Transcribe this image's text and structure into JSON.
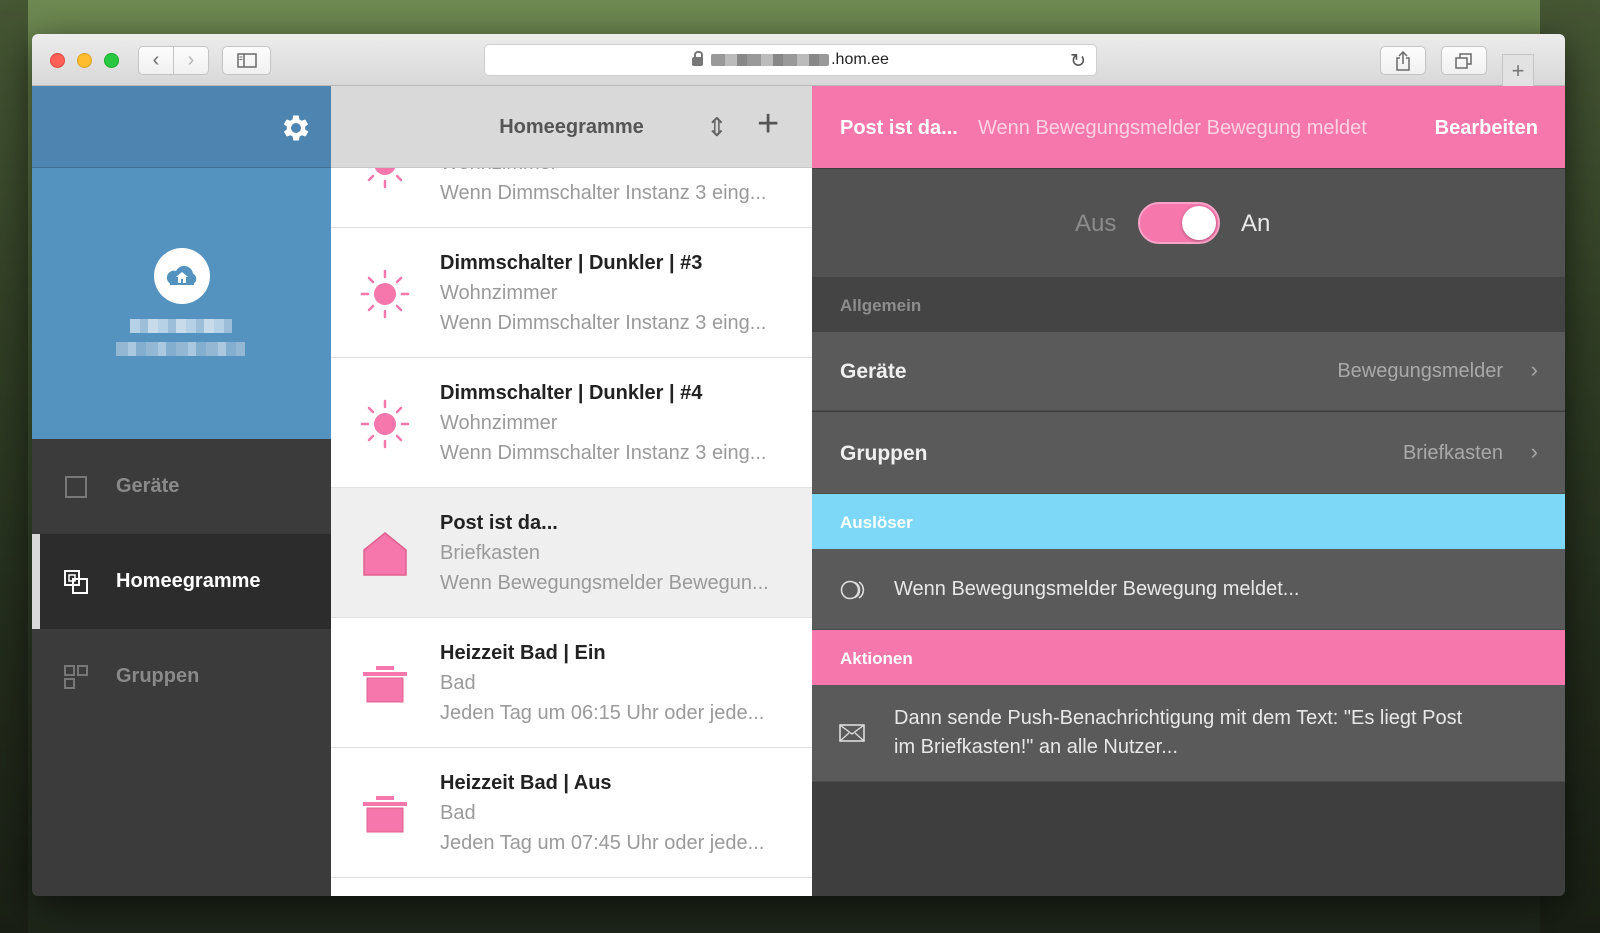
{
  "browser": {
    "url_suffix": ".hom.ee",
    "colors": {
      "close": "#fe5f57",
      "minimize": "#febc2e",
      "maximize": "#28c840"
    }
  },
  "sidebar": {
    "nav": [
      {
        "label": "Geräte",
        "icon": "square-icon",
        "active": false
      },
      {
        "label": "Homeegramme",
        "icon": "homeegram-icon",
        "active": true
      },
      {
        "label": "Gruppen",
        "icon": "groups-icon",
        "active": false
      }
    ]
  },
  "list": {
    "title": "Homeegramme",
    "items": [
      {
        "title": "",
        "subtitle": "Wohnzimmer",
        "description": "Wenn Dimmschalter Instanz 3 eing...",
        "icon": "sun-icon"
      },
      {
        "title": "Dimmschalter | Dunkler | #3",
        "subtitle": "Wohnzimmer",
        "description": "Wenn Dimmschalter Instanz 3 eing...",
        "icon": "sun-icon"
      },
      {
        "title": "Dimmschalter | Dunkler | #4",
        "subtitle": "Wohnzimmer",
        "description": "Wenn Dimmschalter Instanz 3 eing...",
        "icon": "sun-icon"
      },
      {
        "title": "Post ist da...",
        "subtitle": "Briefkasten",
        "description": "Wenn Bewegungsmelder Bewegun...",
        "icon": "house-icon",
        "selected": true
      },
      {
        "title": "Heizzeit Bad | Ein",
        "subtitle": "Bad",
        "description": "Jeden Tag um 06:15 Uhr oder jede...",
        "icon": "pot-icon"
      },
      {
        "title": "Heizzeit Bad | Aus",
        "subtitle": "Bad",
        "description": "Jeden Tag um 07:45 Uhr oder jede...",
        "icon": "pot-icon"
      }
    ]
  },
  "detail": {
    "title": "Post ist da...",
    "trigger_summary": "Wenn Bewegungsmelder Bewegung meldet",
    "edit_label": "Bearbeiten",
    "toggle": {
      "off_label": "Aus",
      "on_label": "An",
      "state": "on"
    },
    "general": {
      "title": "Allgemein",
      "devices_label": "Geräte",
      "devices_value": "Bewegungsmelder",
      "groups_label": "Gruppen",
      "groups_value": "Briefkasten"
    },
    "triggers": {
      "title": "Auslöser",
      "item": "Wenn Bewegungsmelder Bewegung meldet..."
    },
    "actions": {
      "title": "Aktionen",
      "item_line1": "Dann sende Push-Benachrichtigung mit dem Text: \"Es liegt Post",
      "item_line2": "im Briefkasten!\" an alle Nutzer..."
    },
    "colors": {
      "accent": "#f577ab",
      "trigger_header": "#7dd8f7"
    }
  }
}
